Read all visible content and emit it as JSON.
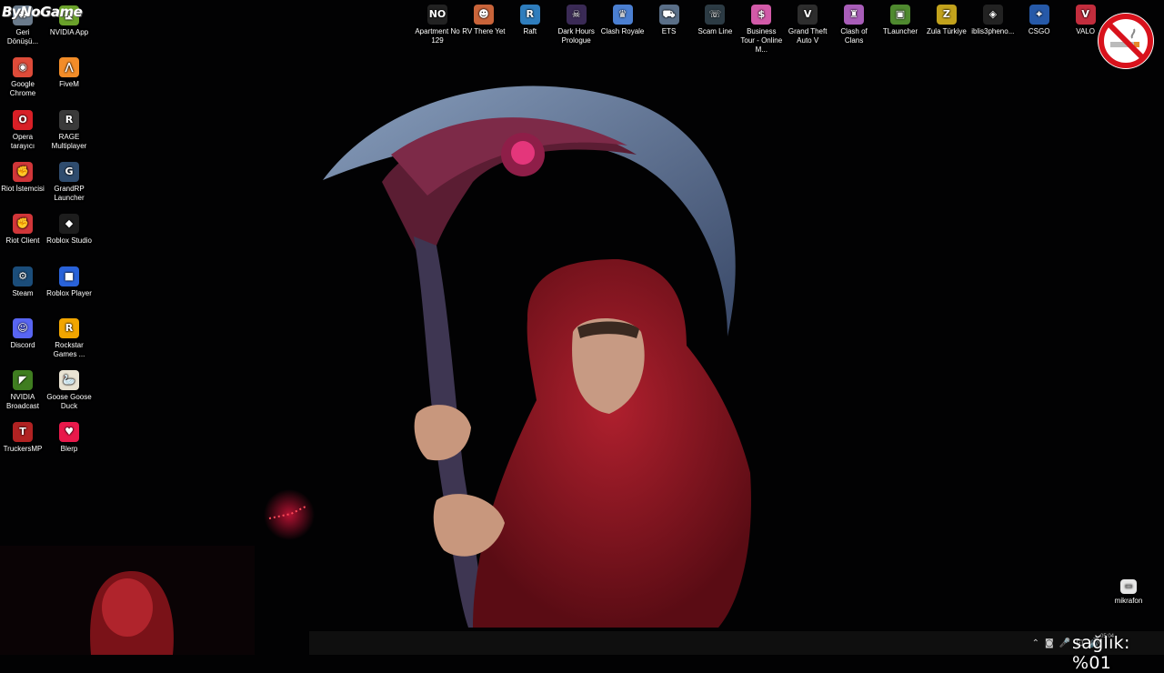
{
  "brand": {
    "logo_text": "ByNoGame"
  },
  "desktop": {
    "left_icons": [
      {
        "label": "Geri Dönüşü...",
        "icon": "recycle-bin-icon",
        "color": "#6b7b8c",
        "glyph": "♻"
      },
      {
        "label": "NVIDIA App",
        "icon": "nvidia-app-icon",
        "color": "#6aa12a",
        "glyph": "◣"
      },
      {
        "label": "Google Chrome",
        "icon": "chrome-icon",
        "color": "#dd4b39",
        "glyph": "◉"
      },
      {
        "label": "FiveM",
        "icon": "fivem-icon",
        "color": "#f28c28",
        "glyph": "⋀"
      },
      {
        "label": "Opera tarayıcı",
        "icon": "opera-icon",
        "color": "#d81f26",
        "glyph": "O"
      },
      {
        "label": "RAGE Multiplayer",
        "icon": "rage-mp-icon",
        "color": "#3a3a3a",
        "glyph": "R"
      },
      {
        "label": "Riot İstemcisi",
        "icon": "riot-client-icon",
        "color": "#d13639",
        "glyph": "✊"
      },
      {
        "label": "GrandRP Launcher",
        "icon": "grandrp-icon",
        "color": "#2f4c6e",
        "glyph": "G"
      },
      {
        "label": "Riot Client",
        "icon": "riot-client-2-icon",
        "color": "#d13639",
        "glyph": "✊"
      },
      {
        "label": "Roblox Studio",
        "icon": "roblox-studio-icon",
        "color": "#1d1d1d",
        "glyph": "◆"
      },
      {
        "label": "Steam",
        "icon": "steam-icon",
        "color": "#1b4d7a",
        "glyph": "⚙"
      },
      {
        "label": "Roblox Player",
        "icon": "roblox-player-icon",
        "color": "#2962d9",
        "glyph": "■"
      },
      {
        "label": "Discord",
        "icon": "discord-icon",
        "color": "#5865f2",
        "glyph": "☺"
      },
      {
        "label": "Rockstar Games ...",
        "icon": "rockstar-icon",
        "color": "#f1a500",
        "glyph": "R"
      },
      {
        "label": "NVIDIA Broadcast",
        "icon": "nvidia-broadcast-icon",
        "color": "#3f7d20",
        "glyph": "◤"
      },
      {
        "label": "Goose Goose Duck",
        "icon": "goose-duck-icon",
        "color": "#e9e3d3",
        "glyph": "🦢"
      },
      {
        "label": "TruckersMP",
        "icon": "truckersmp-icon",
        "color": "#b12222",
        "glyph": "T"
      },
      {
        "label": "Blerp",
        "icon": "blerp-icon",
        "color": "#e8194b",
        "glyph": "♥"
      }
    ],
    "top_icons": [
      {
        "label": "Apartment No 129",
        "icon": "apartment-game-icon",
        "color": "#222222",
        "glyph": "NO"
      },
      {
        "label": "RV There Yet",
        "icon": "rv-there-yet-icon",
        "color": "#c9643a",
        "glyph": "☻"
      },
      {
        "label": "Raft",
        "icon": "raft-icon",
        "color": "#2e7dbd",
        "glyph": "R"
      },
      {
        "label": "Dark Hours Prologue",
        "icon": "dark-hours-icon",
        "color": "#3a2a55",
        "glyph": "☠"
      },
      {
        "label": "Clash Royale",
        "icon": "clash-royale-icon",
        "color": "#4b7fd1",
        "glyph": "♛"
      },
      {
        "label": "ETS",
        "icon": "ets-icon",
        "color": "#5a6f88",
        "glyph": "⛟"
      },
      {
        "label": "Scam Line",
        "icon": "scam-line-icon",
        "color": "#2c3b44",
        "glyph": "☏"
      },
      {
        "label": "Business Tour - Online M...",
        "icon": "business-tour-icon",
        "color": "#d25aa8",
        "glyph": "$"
      },
      {
        "label": "Grand Theft Auto V",
        "icon": "gta5-icon",
        "color": "#2d2d2d",
        "glyph": "V"
      },
      {
        "label": "Clash of Clans",
        "icon": "clash-of-clans-icon",
        "color": "#a85db8",
        "glyph": "♜"
      },
      {
        "label": "TLauncher",
        "icon": "tlauncher-icon",
        "color": "#4f8a2f",
        "glyph": "▣"
      },
      {
        "label": "Zula Türkiye",
        "icon": "zula-icon",
        "color": "#c2a21c",
        "glyph": "Z"
      },
      {
        "label": "iblis3pheno...",
        "icon": "iblis-icon",
        "color": "#222222",
        "glyph": "◈"
      },
      {
        "label": "CSGO",
        "icon": "csgo-icon",
        "color": "#2659a8",
        "glyph": "⌖"
      },
      {
        "label": "VALO",
        "icon": "valorant-icon",
        "color": "#c22d3d",
        "glyph": "V"
      }
    ],
    "bottom_right_icon": {
      "label": "mikrafon",
      "icon": "microphone-file-icon"
    }
  },
  "overlay": {
    "health_text": "sağlık: %01"
  },
  "taskbar": {
    "tray_icons": [
      "chevron-up-icon",
      "camera-icon",
      "microphone-icon",
      "network-icon",
      "speaker-icon"
    ],
    "clock": {
      "time": "05:04"
    }
  }
}
